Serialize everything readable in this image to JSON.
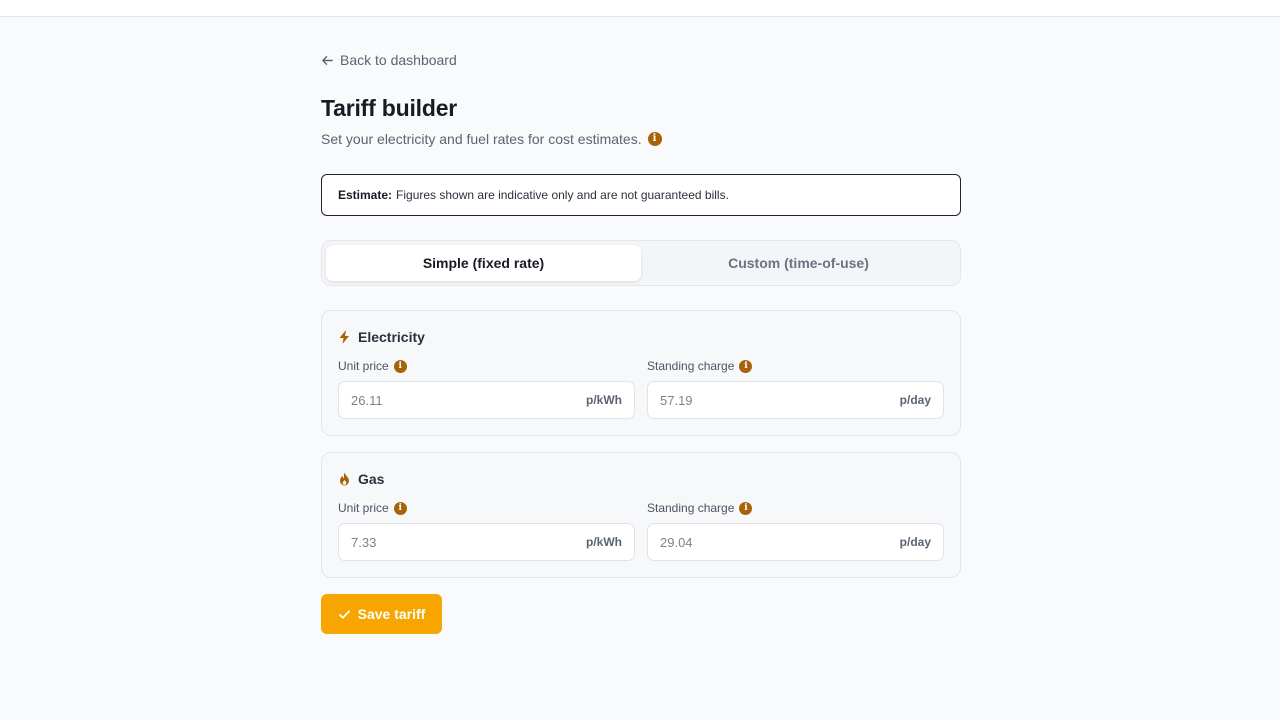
{
  "nav": {
    "back_label": "Back to dashboard"
  },
  "header": {
    "title": "Tariff builder",
    "subtitle": "Set your electricity and fuel rates for cost estimates."
  },
  "notice": {
    "strong": "Estimate:",
    "text": "Figures shown are indicative only and are not guaranteed bills."
  },
  "mode_toggle": {
    "options": [
      {
        "label": "Simple (fixed rate)",
        "active": true
      },
      {
        "label": "Custom (time-of-use)",
        "active": false
      }
    ]
  },
  "electricity": {
    "title": "Electricity",
    "icon": "lightning-icon",
    "unit_price": {
      "label": "Unit price",
      "value": "26.11",
      "unit": "p/kWh"
    },
    "standing_charge": {
      "label": "Standing charge",
      "value": "57.19",
      "unit": "p/day"
    }
  },
  "gas": {
    "title": "Gas",
    "icon": "flame-icon",
    "unit_price": {
      "label": "Unit price",
      "value": "7.33",
      "unit": "p/kWh"
    },
    "standing_charge": {
      "label": "Standing charge",
      "value": "29.04",
      "unit": "p/day"
    }
  },
  "actions": {
    "save_label": "Save tariff"
  },
  "colors": {
    "accent": "#f7a500",
    "info_icon": "#a8620a",
    "background": "#f8fafc"
  }
}
